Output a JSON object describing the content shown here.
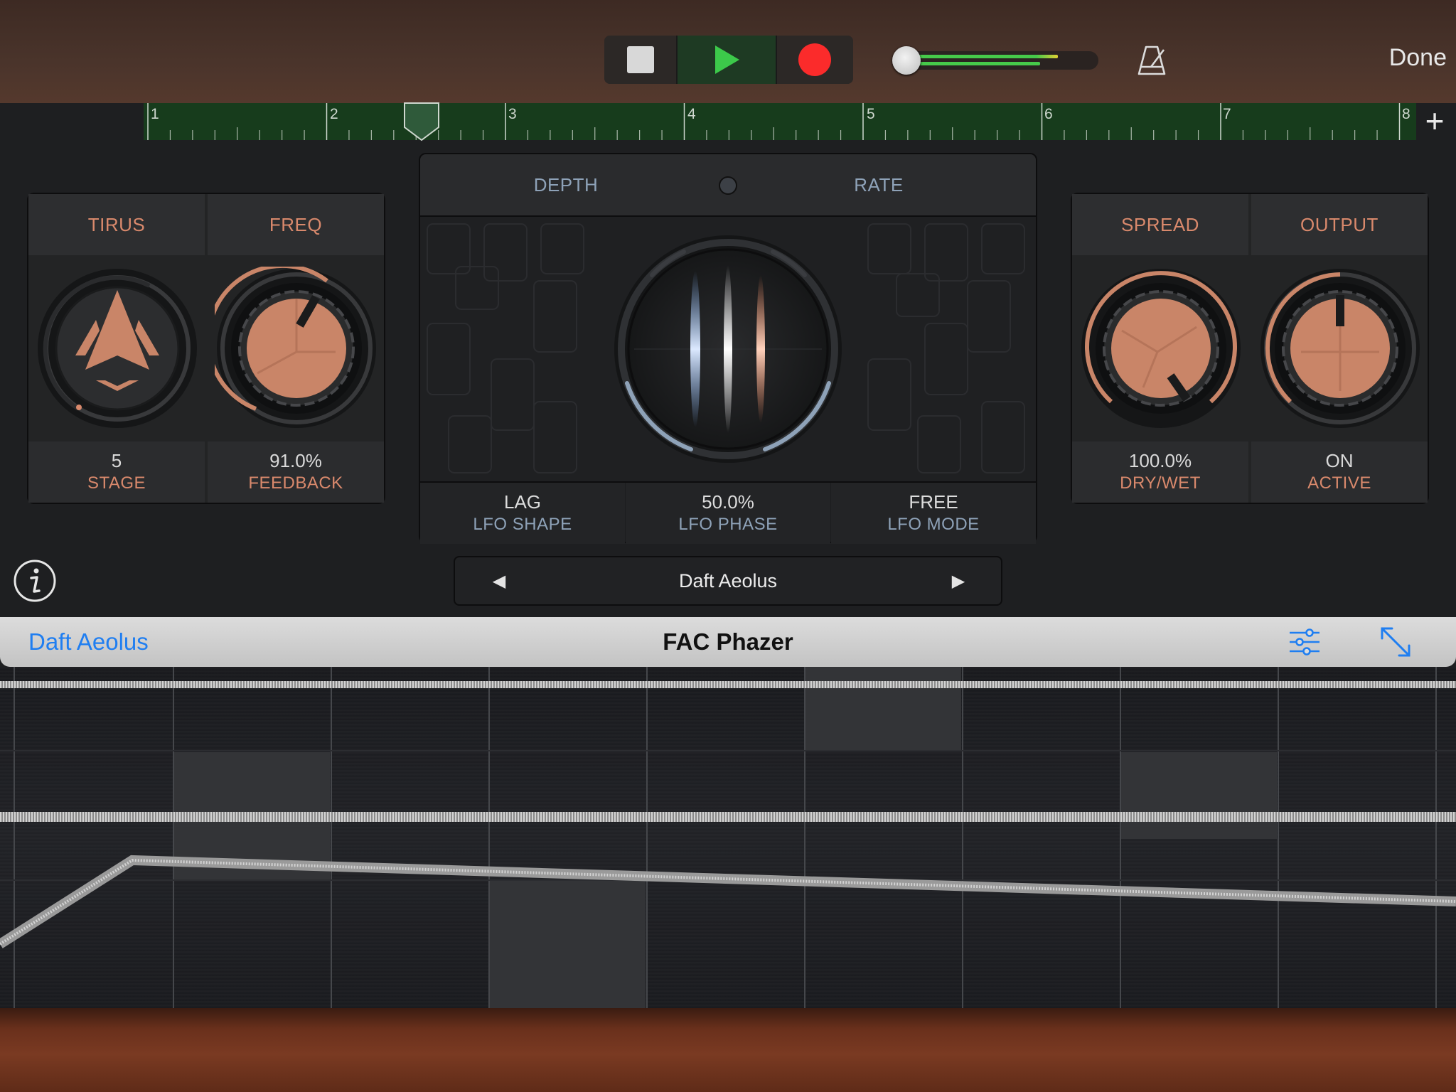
{
  "transport": {
    "done_label": "Done",
    "record_color": "#fb2b2b",
    "play_color": "#3cc94a"
  },
  "ruler": {
    "bars": [
      "1",
      "2",
      "3",
      "4",
      "5",
      "6",
      "7",
      "8"
    ]
  },
  "left_panel": {
    "headers": [
      "TIRUS",
      "FREQ"
    ],
    "controls": [
      {
        "value": "5",
        "label": "STAGE"
      },
      {
        "value": "91.0%",
        "label": "FEEDBACK"
      }
    ]
  },
  "center_panel": {
    "headers": [
      "DEPTH",
      "RATE"
    ],
    "controls": [
      {
        "value": "LAG",
        "label": "LFO SHAPE"
      },
      {
        "value": "50.0%",
        "label": "LFO PHASE"
      },
      {
        "value": "FREE",
        "label": "LFO MODE"
      }
    ]
  },
  "right_panel": {
    "headers": [
      "SPREAD",
      "OUTPUT"
    ],
    "controls": [
      {
        "value": "100.0%",
        "label": "DRY/WET"
      },
      {
        "value": "ON",
        "label": "ACTIVE"
      }
    ]
  },
  "preset": {
    "name": "Daft Aeolus",
    "prev_glyph": "◀",
    "next_glyph": "▶"
  },
  "plugin_bar": {
    "preset_name": "Daft Aeolus",
    "title": "FAC Phazer"
  },
  "colors": {
    "accent_copper": "#d9896c",
    "knob_copper": "#c98568",
    "lfo_label_blue": "#8ea2b8",
    "link_blue": "#1f7ef1"
  }
}
